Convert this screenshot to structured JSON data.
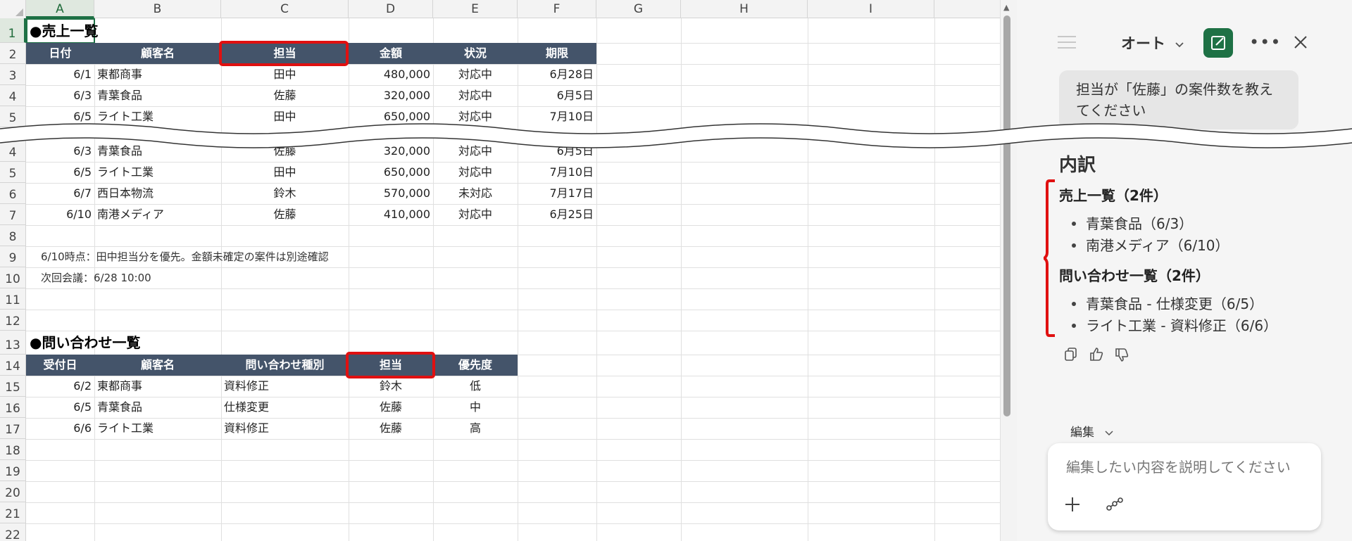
{
  "sheet": {
    "columns": [
      "A",
      "B",
      "C",
      "D",
      "E",
      "F",
      "G",
      "H",
      "I"
    ],
    "rows_top": [
      "1",
      "2",
      "3",
      "4",
      "5"
    ],
    "rows_bottom": [
      "4",
      "5",
      "6",
      "7",
      "8",
      "9",
      "10",
      "11",
      "12",
      "13",
      "14",
      "15",
      "16",
      "17",
      "18",
      "19",
      "20",
      "21",
      "22"
    ],
    "sales_title": "●売上一覧",
    "sales_headers": [
      "日付",
      "顧客名",
      "担当",
      "金額",
      "状況",
      "期限"
    ],
    "sales_top": [
      [
        "6/1",
        "東都商事",
        "田中",
        "480,000",
        "対応中",
        "6月28日"
      ],
      [
        "6/3",
        "青葉食品",
        "佐藤",
        "320,000",
        "対応中",
        "6月5日"
      ],
      [
        "6/5",
        "ライト工業",
        "田中",
        "650,000",
        "対応中",
        "7月10日"
      ]
    ],
    "sales_bottom": [
      [
        "6/3",
        "青葉食品",
        "佐藤",
        "320,000",
        "対応中",
        "6月5日"
      ],
      [
        "6/5",
        "ライト工業",
        "田中",
        "650,000",
        "対応中",
        "7月10日"
      ],
      [
        "6/7",
        "西日本物流",
        "鈴木",
        "570,000",
        "未対応",
        "7月17日"
      ],
      [
        "6/10",
        "南港メディア",
        "佐藤",
        "410,000",
        "対応中",
        "6月25日"
      ]
    ],
    "note1": "6/10時点：田中担当分を優先。金額未確定の案件は別途確認",
    "note2": "次回会議：6/28 10:00",
    "inquiry_title": "●問い合わせ一覧",
    "inquiry_headers": [
      "受付日",
      "顧客名",
      "問い合わせ種別",
      "担当",
      "優先度"
    ],
    "inquiry_rows": [
      [
        "6/2",
        "東都商事",
        "資料修正",
        "鈴木",
        "低"
      ],
      [
        "6/5",
        "青葉食品",
        "仕様変更",
        "佐藤",
        "中"
      ],
      [
        "6/6",
        "ライト工業",
        "資料修正",
        "佐藤",
        "高"
      ]
    ]
  },
  "pane": {
    "mode_label": "オート",
    "user_message": "担当が「佐藤」の案件数を教えてください",
    "breakdown_title": "内訳",
    "section1_title": "売上一覧（2件）",
    "section1_items": [
      "青葉食品（6/3）",
      "南港メディア（6/10）"
    ],
    "section2_title": "問い合わせ一覧（2件）",
    "section2_items": [
      "青葉食品 - 仕様変更（6/5）",
      "ライト工業 - 資料修正（6/6）"
    ],
    "edit_label": "編集",
    "input_placeholder": "編集したい内容を説明してください"
  },
  "colors": {
    "header_bar": "#44546a",
    "highlight": "#e01010",
    "accent": "#1e7145"
  }
}
